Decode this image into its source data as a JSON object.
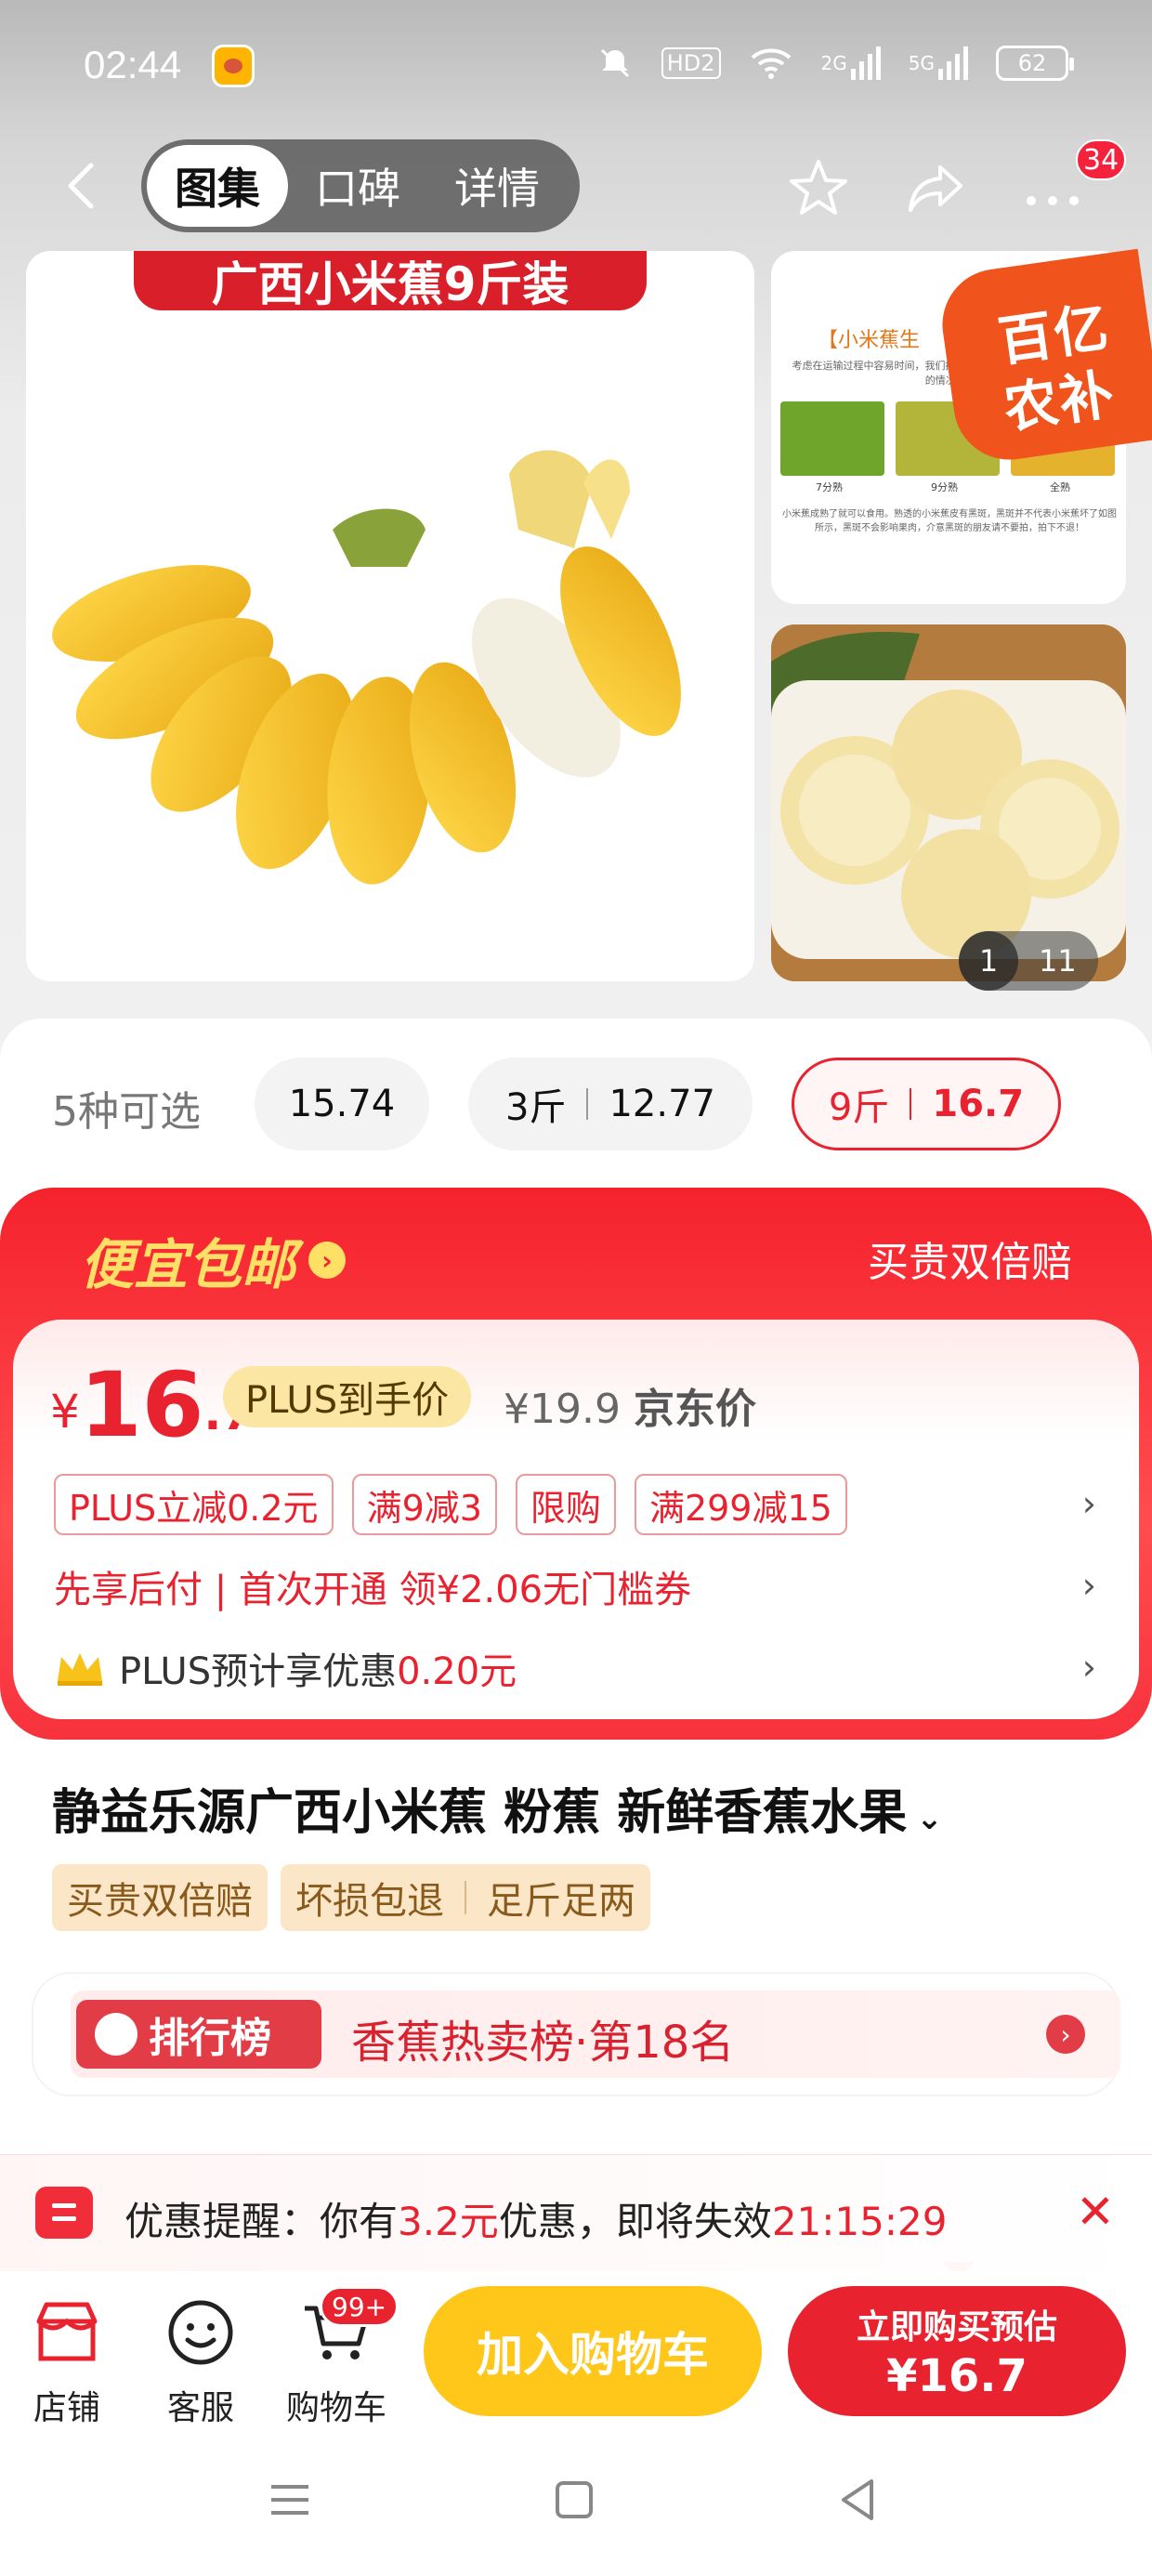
{
  "status_bar": {
    "time": "02:44",
    "battery": "62",
    "hd_label": "HD2",
    "signal1": "2G",
    "signal2": "5G"
  },
  "nav": {
    "tabs": [
      "图集",
      "口碑",
      "详情"
    ],
    "more_badge": "34"
  },
  "gallery": {
    "main_banner": "广西小米蕉9斤装",
    "side_title": "【小米蕉生",
    "side_text": "考虑在运输过程中容易时间，我们挑选成熟的好果子。收到货后没有熟的情况请...",
    "ripeness_labels": [
      "7分熟",
      "9分熟",
      "全熟"
    ],
    "side_footer": "小米蕉成熟了就可以食用。熟透的小米蕉皮有黑斑，黑斑并不代表小米蕉坏了如图所示，黑斑不会影响果肉，介意黑斑的朋友请不要拍，拍下不退！",
    "promo_sticker_line1": "百亿",
    "promo_sticker_line2": "农补",
    "pager_current": "1",
    "pager_total": "11"
  },
  "variants": {
    "label": "5种可选",
    "options": [
      {
        "weight": "",
        "price": "15.74"
      },
      {
        "weight": "3斤",
        "price": "12.77"
      },
      {
        "weight": "9斤",
        "price": "16.7"
      }
    ]
  },
  "promo": {
    "head_left": "便宜包邮",
    "head_right": "买贵双倍赔",
    "currency": "¥",
    "price_int": "16",
    "price_dec": ".7",
    "plus_tag": "PLUS到手价",
    "orig_price": "¥19.9",
    "orig_label": "京东价",
    "coupons": [
      "PLUS立减0.2元",
      "满9减3",
      "限购",
      "满299减15"
    ],
    "credit_text": "先享后付 | 首次开通 领¥2.06无门槛券",
    "plus_save_prefix": "PLUS预计享优惠",
    "plus_save_amount": "0.20元"
  },
  "product": {
    "title": "静益乐源广西小米蕉 粉蕉 新鲜香蕉水果",
    "tags": [
      "买贵双倍赔",
      "坏损包退",
      "足斤足两"
    ]
  },
  "rank": {
    "badge": "排行榜",
    "text": "香蕉热卖榜·第18名"
  },
  "reminder": {
    "prefix": "优惠提醒：你有",
    "amount": "3.2元",
    "middle": "优惠，即将失效",
    "countdown": "21:15:29"
  },
  "bottom": {
    "shop": "店铺",
    "service": "客服",
    "cart": "购物车",
    "cart_badge": "99+",
    "add_to_cart": "加入购物车",
    "buy_now": "立即购买预估",
    "buy_price": "¥16.7"
  },
  "colors": {
    "accent_red": "#e8232f",
    "cart_yellow": "#ffc71a",
    "promo_yellow": "#ffe066"
  }
}
